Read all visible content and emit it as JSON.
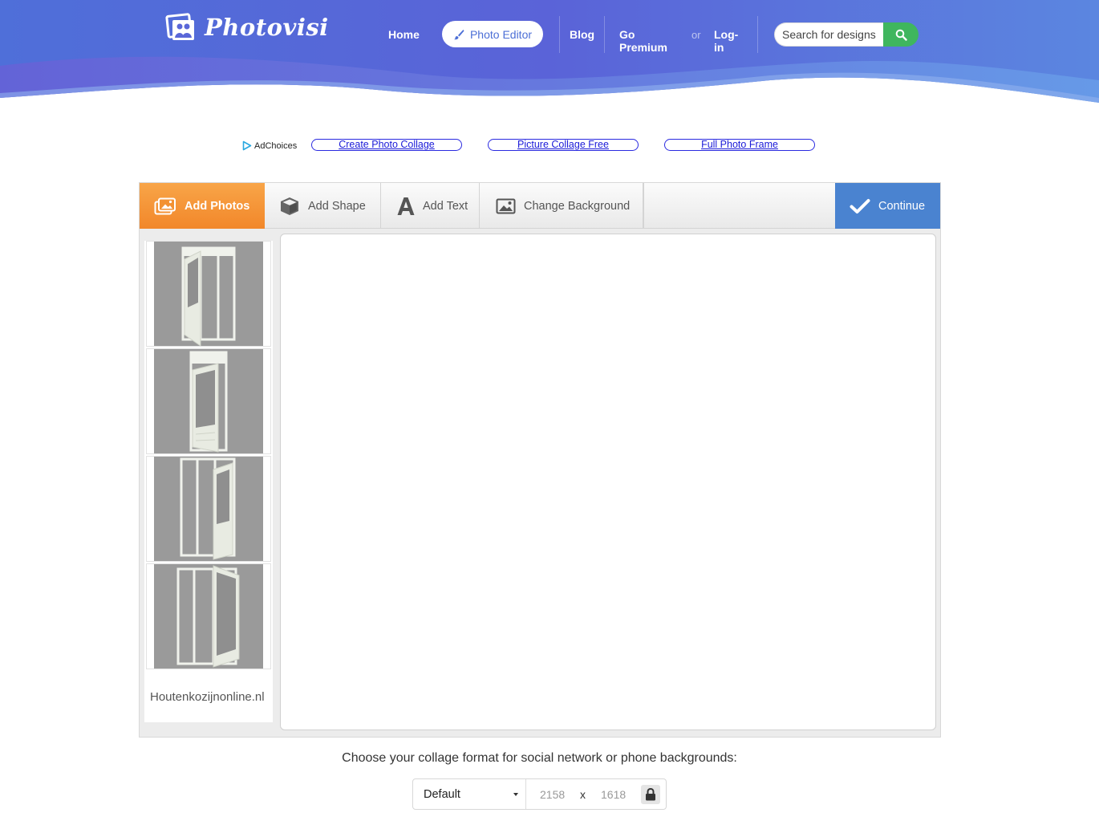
{
  "brand": {
    "name": "Photovisi"
  },
  "nav": {
    "home": "Home",
    "photo_editor": "Photo Editor",
    "blog": "Blog",
    "go_premium": "Go Premium",
    "or": "or",
    "login": "Log-in"
  },
  "search": {
    "placeholder": "Search for designs"
  },
  "ads": {
    "adchoices": "AdChoices",
    "links": [
      "Create Photo Collage",
      "Picture Collage Free",
      "Full Photo Frame"
    ],
    "side_domain": "Houtenkozijnonline.nl"
  },
  "toolbar": {
    "add_photos": "Add Photos",
    "add_shape": "Add Shape",
    "add_text": "Add Text",
    "change_background": "Change Background",
    "continue": "Continue"
  },
  "format": {
    "label": "Choose your collage format for social network or phone backgrounds:",
    "selected": "Default",
    "width": "2158",
    "x": "x",
    "height": "1618"
  },
  "colors": {
    "header_blue": "#4a6bd8",
    "add_photos_orange": "#f39232",
    "continue_blue": "#4a83d0",
    "search_green": "#3fb65e",
    "ad_link": "#1a1ad8"
  }
}
